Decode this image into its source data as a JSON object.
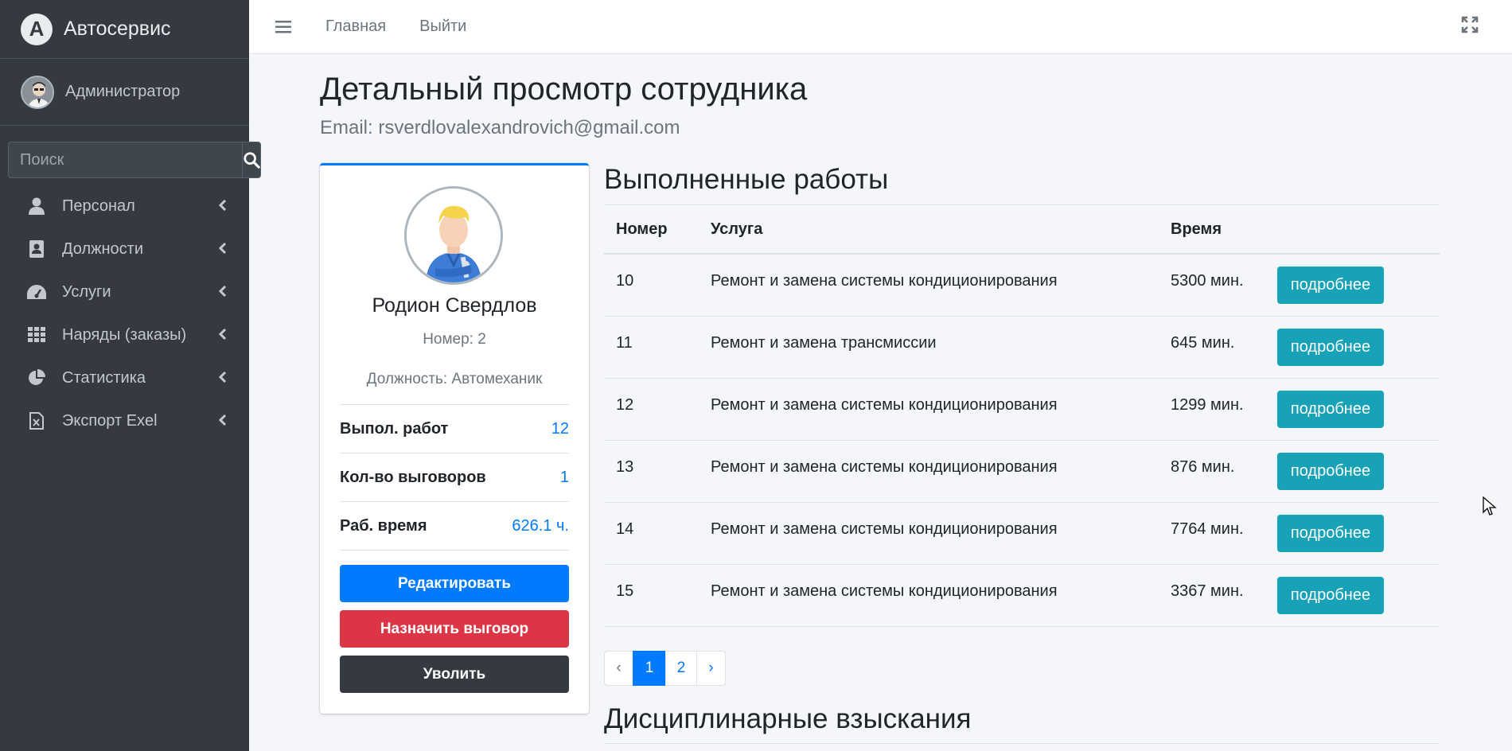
{
  "brand": {
    "logo_letter": "A",
    "name": "Автосервис"
  },
  "user": {
    "name": "Администратор"
  },
  "search": {
    "placeholder": "Поиск"
  },
  "sidebar": {
    "items": [
      {
        "label": "Персонал",
        "icon": "user-icon"
      },
      {
        "label": "Должности",
        "icon": "id-card-icon"
      },
      {
        "label": "Услуги",
        "icon": "tachometer-icon"
      },
      {
        "label": "Наряды (заказы)",
        "icon": "grid-icon"
      },
      {
        "label": "Статистика",
        "icon": "pie-chart-icon"
      },
      {
        "label": "Экспорт Exel",
        "icon": "excel-file-icon"
      }
    ]
  },
  "topbar": {
    "home": "Главная",
    "logout": "Выйти"
  },
  "page": {
    "title": "Детальный просмотр сотрудника",
    "subtitle": "Email: rsverdlovalexandrovich@gmail.com"
  },
  "profile": {
    "name": "Родион Свердлов",
    "number": "Номер: 2",
    "position": "Должность: Автомеханик",
    "stats": [
      {
        "label": "Выпол. работ",
        "value": "12"
      },
      {
        "label": "Кол-во выговоров",
        "value": "1"
      },
      {
        "label": "Раб. время",
        "value": "626.1 ч."
      }
    ],
    "buttons": {
      "edit": "Редактировать",
      "warn": "Назначить выговор",
      "fire": "Уволить"
    }
  },
  "works": {
    "title": "Выполненные работы",
    "headers": {
      "num": "Номер",
      "service": "Услуга",
      "time": "Время"
    },
    "rows": [
      {
        "num": "10",
        "service": "Ремонт и замена системы кондиционирования",
        "time": "5300 мин.",
        "action": "подробнее"
      },
      {
        "num": "11",
        "service": "Ремонт и замена трансмиссии",
        "time": "645 мин.",
        "action": "подробнее"
      },
      {
        "num": "12",
        "service": "Ремонт и замена системы кондиционирования",
        "time": "1299 мин.",
        "action": "подробнее"
      },
      {
        "num": "13",
        "service": "Ремонт и замена системы кондиционирования",
        "time": "876 мин.",
        "action": "подробнее"
      },
      {
        "num": "14",
        "service": "Ремонт и замена системы кондиционирования",
        "time": "7764 мин.",
        "action": "подробнее"
      },
      {
        "num": "15",
        "service": "Ремонт и замена системы кондиционирования",
        "time": "3367 мин.",
        "action": "подробнее"
      }
    ]
  },
  "pagination": {
    "prev": "‹",
    "pages": [
      "1",
      "2"
    ],
    "next": "›",
    "current": "1"
  },
  "discipline": {
    "title": "Дисциплинарные взыскания"
  },
  "colors": {
    "primary": "#007bff",
    "danger": "#dc3545",
    "dark": "#343a40",
    "info": "#17a2b8",
    "sidebar": "#343a40"
  }
}
